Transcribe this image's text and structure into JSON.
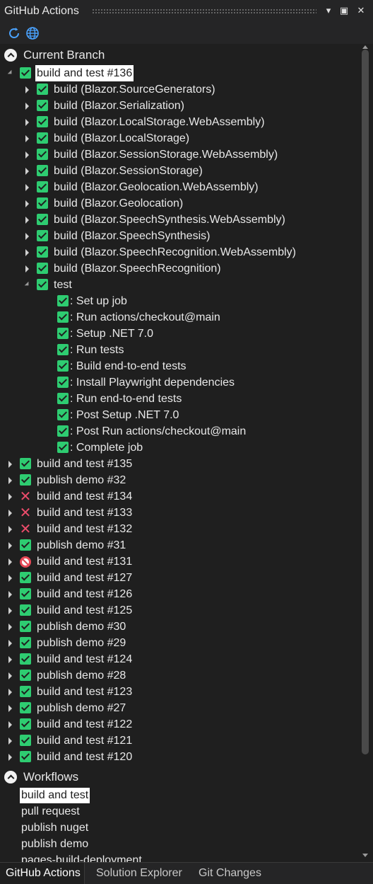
{
  "window": {
    "title": "GitHub Actions"
  },
  "colors": {
    "success": "#2ecc71",
    "failure": "#ec4c6b",
    "cancelled": "#e74856",
    "selection": "#ffffff",
    "background": "#1f1f1f"
  },
  "toolbar": {
    "refresh_icon": "refresh-icon",
    "browser_icon": "globe-icon"
  },
  "current_branch": {
    "label": "Current Branch",
    "run": {
      "label": "build and test #136",
      "status": "success"
    },
    "jobs": [
      "build (Blazor.SourceGenerators)",
      "build (Blazor.Serialization)",
      "build (Blazor.LocalStorage.WebAssembly)",
      "build (Blazor.LocalStorage)",
      "build (Blazor.SessionStorage.WebAssembly)",
      "build (Blazor.SessionStorage)",
      "build (Blazor.Geolocation.WebAssembly)",
      "build (Blazor.Geolocation)",
      "build (Blazor.SpeechSynthesis.WebAssembly)",
      "build (Blazor.SpeechSynthesis)",
      "build (Blazor.SpeechRecognition.WebAssembly)",
      "build (Blazor.SpeechRecognition)"
    ],
    "test_job": {
      "label": "test",
      "steps": [
        ": Set up job",
        ": Run actions/checkout@main",
        ": Setup .NET 7.0",
        ": Run tests",
        ": Build end-to-end tests",
        ": Install Playwright dependencies",
        ": Run end-to-end tests",
        ": Post Setup .NET 7.0",
        ": Post Run actions/checkout@main",
        ": Complete job"
      ]
    },
    "other_runs": [
      {
        "label": "build and test #135",
        "status": "success"
      },
      {
        "label": "publish demo #32",
        "status": "success"
      },
      {
        "label": "build and test #134",
        "status": "failure"
      },
      {
        "label": "build and test #133",
        "status": "failure"
      },
      {
        "label": "build and test #132",
        "status": "failure"
      },
      {
        "label": "publish demo #31",
        "status": "success"
      },
      {
        "label": "build and test #131",
        "status": "cancelled"
      },
      {
        "label": "build and test #127",
        "status": "success"
      },
      {
        "label": "build and test #126",
        "status": "success"
      },
      {
        "label": "build and test #125",
        "status": "success"
      },
      {
        "label": "publish demo #30",
        "status": "success"
      },
      {
        "label": "publish demo #29",
        "status": "success"
      },
      {
        "label": "build and test #124",
        "status": "success"
      },
      {
        "label": "publish demo #28",
        "status": "success"
      },
      {
        "label": "build and test #123",
        "status": "success"
      },
      {
        "label": "publish demo #27",
        "status": "success"
      },
      {
        "label": "build and test #122",
        "status": "success"
      },
      {
        "label": "build and test #121",
        "status": "success"
      },
      {
        "label": "build and test #120",
        "status": "success"
      }
    ]
  },
  "workflows": {
    "label": "Workflows",
    "items": [
      "build and test",
      "pull request",
      "publish nuget",
      "publish demo",
      "pages-build-deployment"
    ]
  },
  "tabs": [
    "GitHub Actions",
    "Solution Explorer",
    "Git Changes"
  ]
}
